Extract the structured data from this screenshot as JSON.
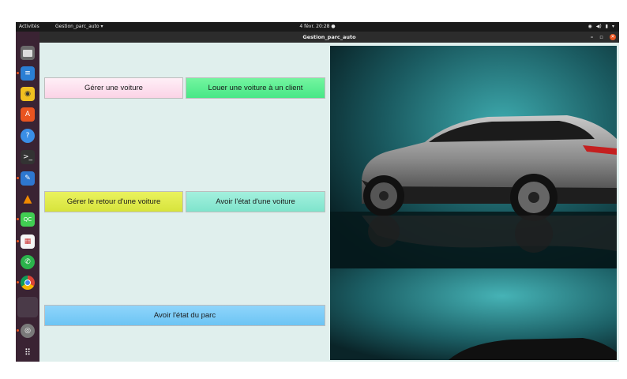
{
  "topbar": {
    "activities": "Activités",
    "app_menu": "Gestion_parc_auto ▾",
    "clock": "4 févr.  20:28  ●",
    "tray": [
      "◉",
      "◀)",
      "▮",
      "▾"
    ]
  },
  "window": {
    "title": "Gestion_parc_auto",
    "controls": {
      "minimize": "–",
      "maximize": "▫",
      "close": "✕"
    }
  },
  "buttons": {
    "manage_car": "Gérer une voiture",
    "rent_car": "Louer une voiture à un client",
    "return_car": "Gérer le retour d'une voiture",
    "car_state": "Avoir l'état d'une voiture",
    "park_state": "Avoir l'état du parc"
  },
  "dock": {
    "icons": [
      "files-icon",
      "writer-icon",
      "rhythmbox-icon",
      "software-center-icon",
      "help-icon",
      "terminal-icon",
      "text-editor-icon",
      "vlc-icon",
      "qt-creator-icon",
      "calendar-icon",
      "whatsapp-icon",
      "chrome-icon",
      "blank-icon",
      "disc-icon",
      "app-grid-icon"
    ],
    "colors": {
      "accent": "#e95420",
      "dock_bg": "#3a2333"
    }
  },
  "colors": {
    "content_bg": "#e0efed",
    "manage": "#fbd3e6",
    "rent": "#47e787",
    "return": "#d7e43c",
    "state": "#7fe4cc",
    "park": "#6cc4f4"
  }
}
